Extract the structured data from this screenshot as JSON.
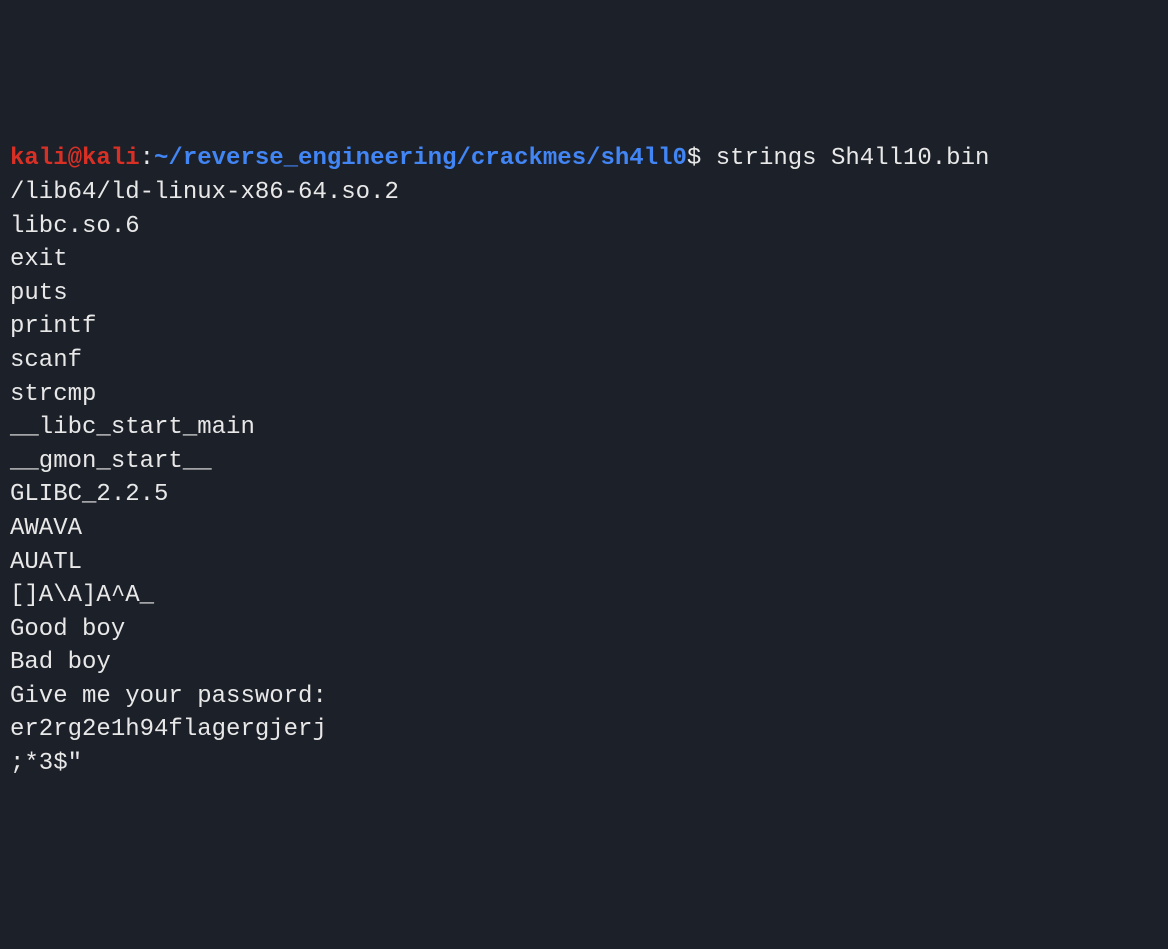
{
  "prompt": {
    "user_host": "kali@kali",
    "colon": ":",
    "path": "~/reverse_engineering/crackmes/sh4ll0",
    "dollar": "$",
    "command": " strings Sh4ll10.bin"
  },
  "output_lines": [
    "/lib64/ld-linux-x86-64.so.2",
    "libc.so.6",
    "exit",
    "puts",
    "printf",
    "scanf",
    "strcmp",
    "__libc_start_main",
    "__gmon_start__",
    "GLIBC_2.2.5",
    "AWAVA",
    "AUATL",
    "[]A\\A]A^A_",
    "Good boy",
    "Bad boy",
    "Give me your password: ",
    "er2rg2e1h94flagergjerj",
    ";*3$\""
  ]
}
